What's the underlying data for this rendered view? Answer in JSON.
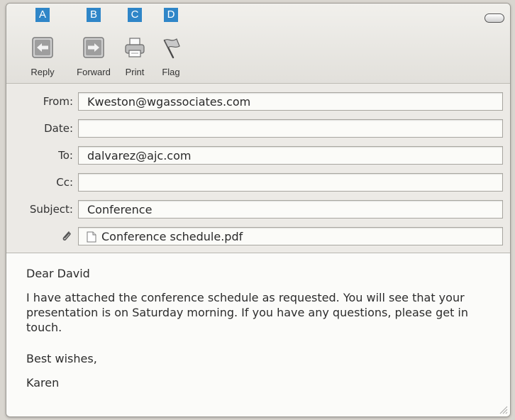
{
  "toolbar": {
    "buttons": [
      {
        "key": "A",
        "label": "Reply",
        "icon": "reply-icon"
      },
      {
        "key": "B",
        "label": "Forward",
        "icon": "forward-icon"
      },
      {
        "key": "C",
        "label": "Print",
        "icon": "printer-icon"
      },
      {
        "key": "D",
        "label": "Flag",
        "icon": "flag-icon"
      }
    ]
  },
  "header": {
    "from_label": "From:",
    "from_value": "Kweston@wgassociates.com",
    "date_label": "Date:",
    "date_value": "",
    "to_label": "To:",
    "to_value": "dalvarez@ajc.com",
    "cc_label": "Cc:",
    "cc_value": "",
    "subject_label": "Subject:",
    "subject_value": "Conference",
    "attachment_name": "Conference schedule.pdf"
  },
  "body": {
    "greeting": "Dear David",
    "paragraph": "I have attached the conference schedule as requested. You will see that your presentation is on Saturday morning. If you have any questions, please get in touch.",
    "closing": "Best wishes,",
    "signature": "Karen"
  },
  "colors": {
    "key_badge": "#2f86c8",
    "window_bg": "#ecebe7",
    "field_bg": "#fbfbf8"
  }
}
